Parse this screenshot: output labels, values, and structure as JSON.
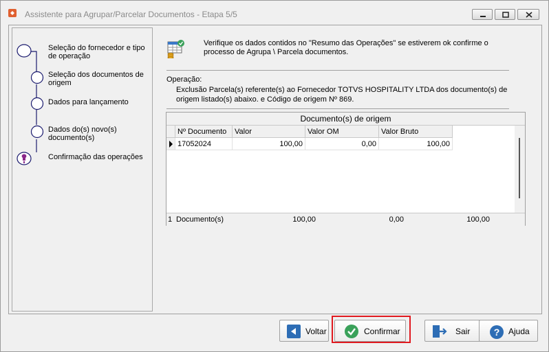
{
  "window": {
    "title": "Assistente para Agrupar/Parcelar Documentos - Etapa 5/5"
  },
  "steps": [
    {
      "label": "Seleção do fornecedor e tipo de operação"
    },
    {
      "label": "Seleção dos documentos de origem"
    },
    {
      "label": "Dados para lançamento"
    },
    {
      "label": "Dados do(s) novo(s) documento(s)"
    },
    {
      "label": "Confirmação das operações"
    }
  ],
  "intro": "Verifique os dados contidos no \"Resumo das Operações\" se estiverem ok confirme o processo de Agrupa \\ Parcela documentos.",
  "operation": {
    "label": "Operação:",
    "text": "Exclusão Parcela(s) referente(s) ao Fornecedor TOTVS HOSPITALITY LTDA dos documento(s) de origem listado(s) abaixo. e Código de origem Nº 869."
  },
  "grid": {
    "caption": "Documento(s) de origem",
    "columns": [
      "Nº Documento",
      "Valor",
      "Valor OM",
      "Valor Bruto"
    ],
    "rows": [
      {
        "doc": "17052024",
        "valor": "100,00",
        "valor_om": "0,00",
        "valor_bruto": "100,00"
      }
    ],
    "footer": {
      "count": "1",
      "count_label": "Documento(s)",
      "valor": "100,00",
      "valor_om": "0,00",
      "valor_bruto": "100,00"
    }
  },
  "buttons": {
    "voltar": "Voltar",
    "confirmar": "Confirmar",
    "sair": "Sair",
    "ajuda": "Ajuda"
  },
  "colors": {
    "accent_highlight": "#e0191f",
    "current_step": "#8b2a8b",
    "step_line": "#1a1a6e"
  }
}
